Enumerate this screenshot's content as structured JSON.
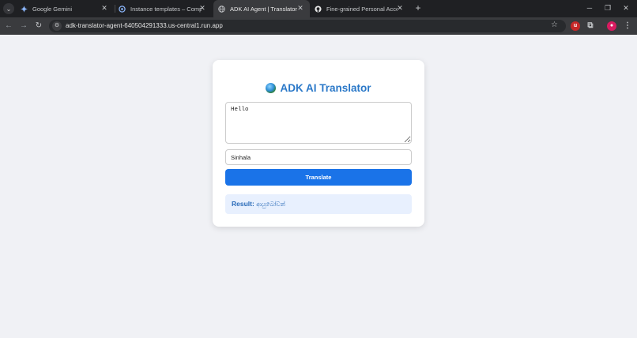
{
  "browser": {
    "tabs": [
      {
        "title": "Google Gemini",
        "icon": "gemini-icon",
        "active": false
      },
      {
        "title": "Instance templates – Compute",
        "icon": "google-cloud-icon",
        "active": false
      },
      {
        "title": "ADK AI Agent | Translator",
        "icon": "globe-icon",
        "active": true
      },
      {
        "title": "Fine-grained Personal Access T",
        "icon": "github-icon",
        "active": false
      }
    ],
    "url": "adk-translator-agent-640504291333.us-central1.run.app",
    "accent_colors": {
      "chrome_dark": "#1f2023",
      "toolbar": "#3a3b3e"
    }
  },
  "app": {
    "title": "ADK AI Translator",
    "title_icon": "globe-icon",
    "source_text": "Hello",
    "target_language": "Sinhala",
    "translate_label": "Translate",
    "result_label": "Result:",
    "result_value": "ආයුබෝවන්",
    "colors": {
      "accent": "#1a73e8",
      "title": "#2a78c8",
      "result_bg": "#e8f0fe",
      "page_bg": "#f0f1f5"
    }
  }
}
